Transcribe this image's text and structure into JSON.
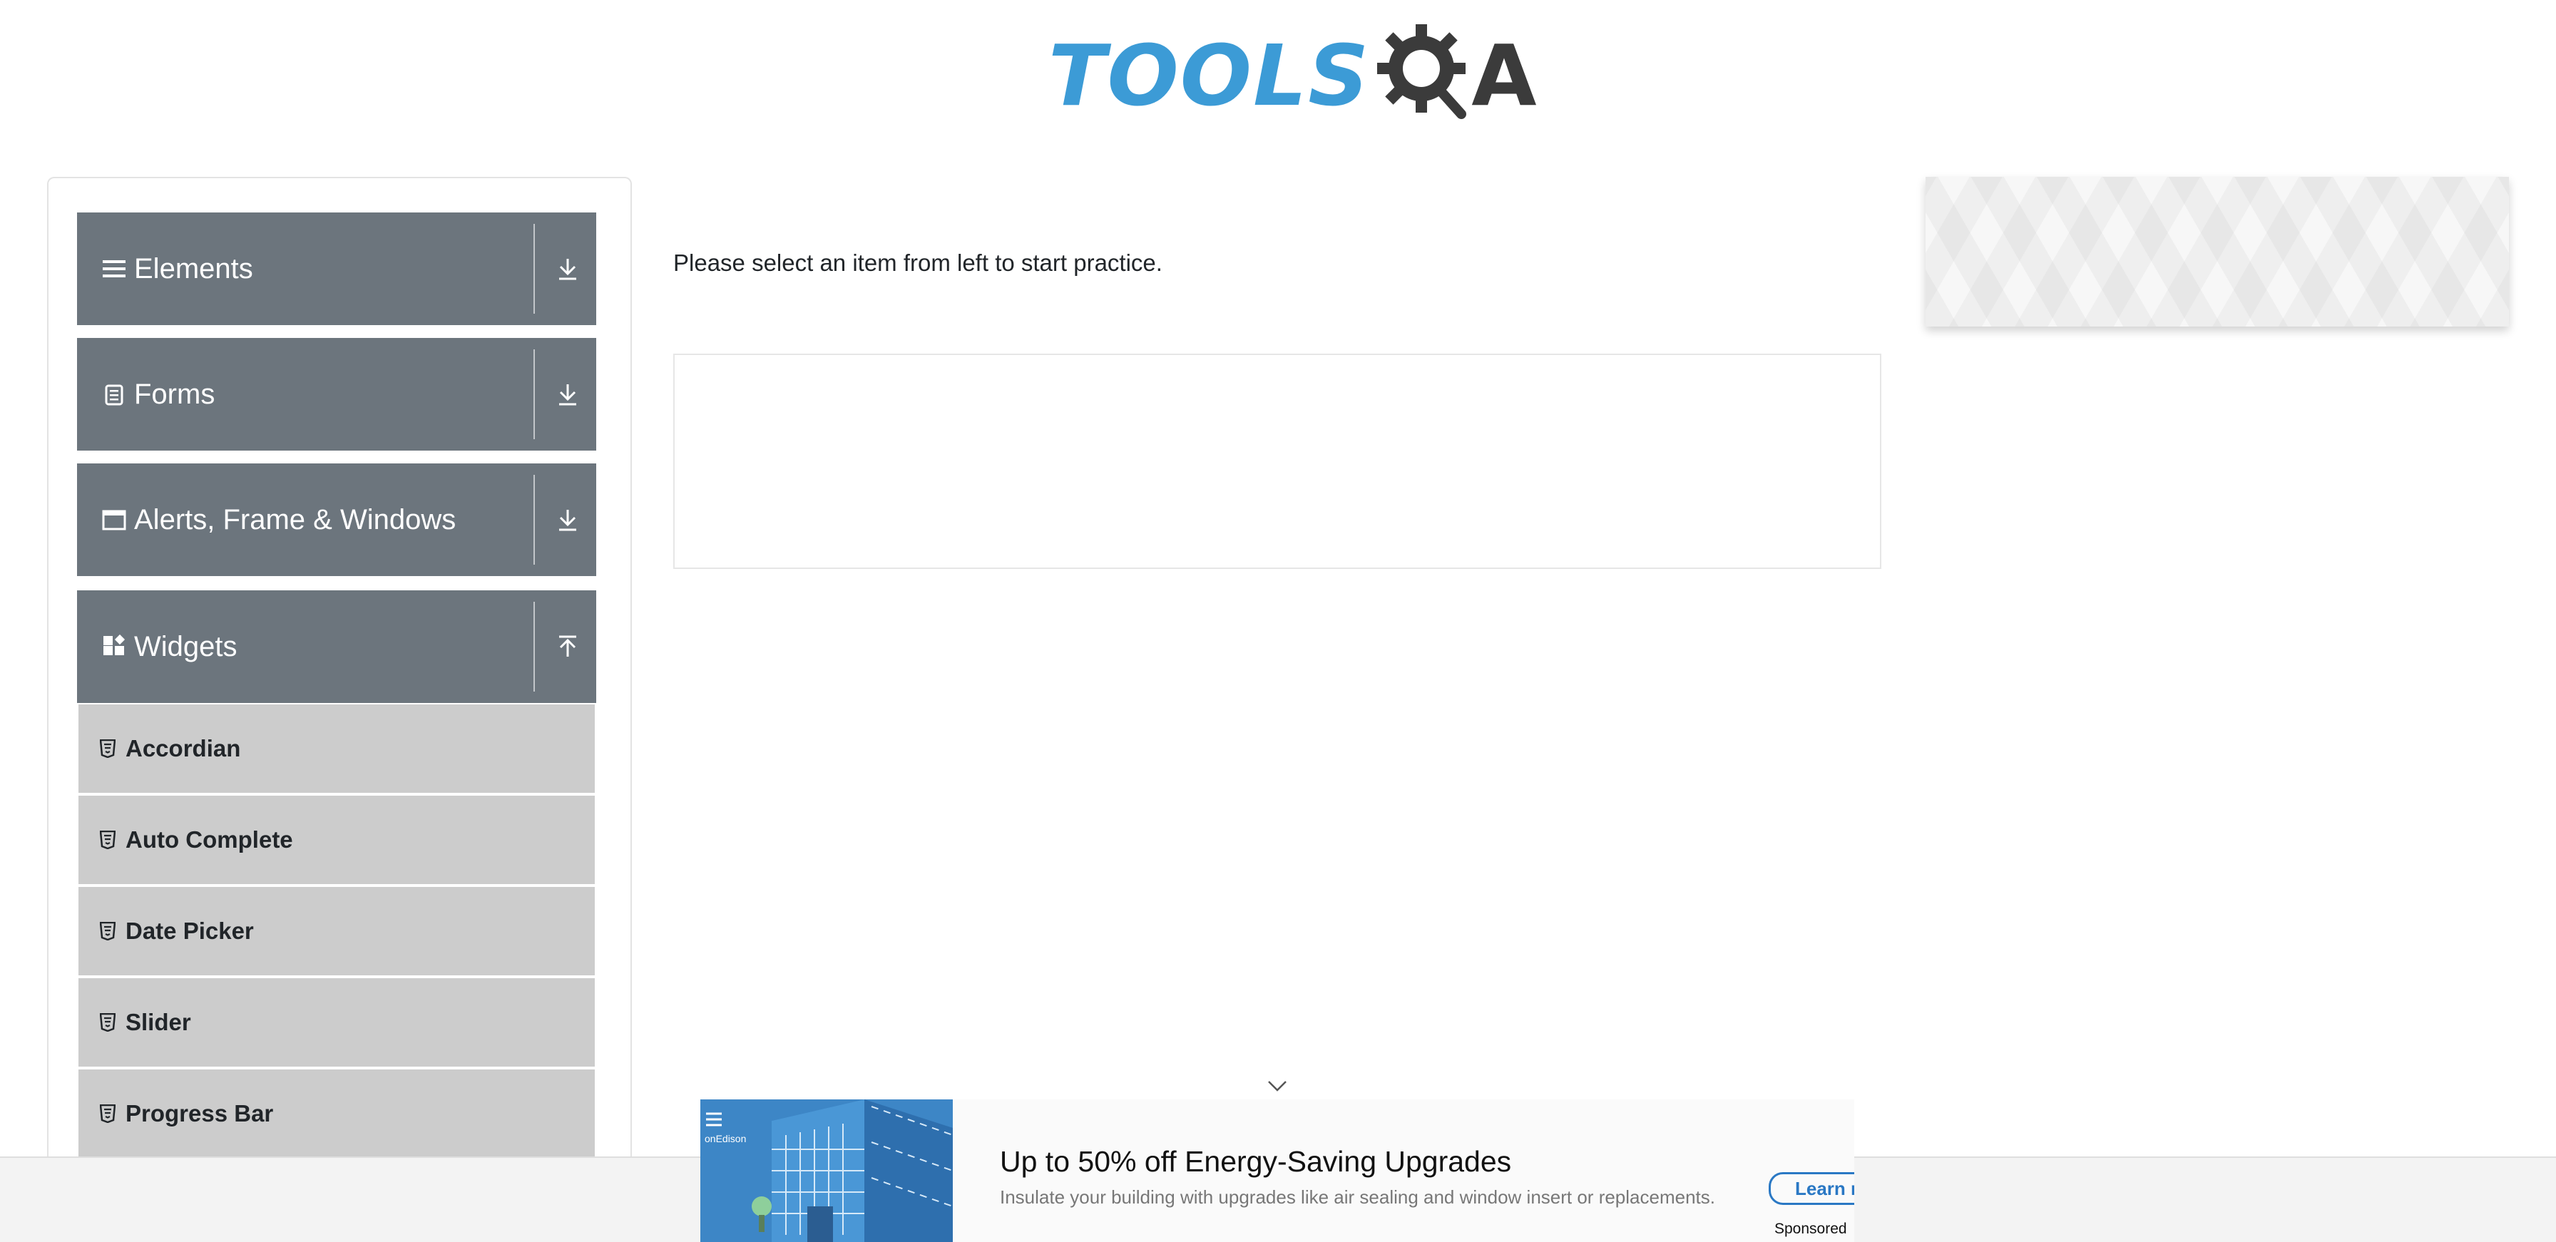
{
  "logo": {
    "text_main": "TOOLS",
    "text_end": "A",
    "colors": {
      "blue": "#3c9bd6",
      "dark": "#3b3b3b"
    }
  },
  "sidebar": {
    "groups": [
      {
        "label": "Elements",
        "icon": "hamburger-icon",
        "toggle_icon": "download-arrow-icon"
      },
      {
        "label": "Forms",
        "icon": "document-icon",
        "toggle_icon": "download-arrow-icon"
      },
      {
        "label": "Alerts, Frame & Windows",
        "icon": "window-icon",
        "toggle_icon": "download-arrow-icon"
      },
      {
        "label": "Widgets",
        "icon": "widgets-icon",
        "toggle_icon": "upload-arrow-icon"
      }
    ],
    "widget_items": [
      {
        "label": "Accordian",
        "icon": "html5-icon"
      },
      {
        "label": "Auto Complete",
        "icon": "html5-icon"
      },
      {
        "label": "Date Picker",
        "icon": "html5-icon"
      },
      {
        "label": "Slider",
        "icon": "html5-icon"
      },
      {
        "label": "Progress Bar",
        "icon": "html5-icon"
      }
    ],
    "colors": {
      "header_bg": "#6c757d",
      "item_bg": "#cccccc"
    }
  },
  "main": {
    "prompt": "Please select an item from left to start practice."
  },
  "bottom_ad": {
    "title": "Up to 50% off Energy-Saving Upgrades",
    "subtitle": "Insulate your building with upgrades like air sealing and window insert or replacements.",
    "button": "Learn m",
    "sponsored": "Sponsored",
    "brand_fragment": "onEdison",
    "colors": {
      "accent": "#2a78c4",
      "image_bg": "#3d86c6"
    }
  }
}
